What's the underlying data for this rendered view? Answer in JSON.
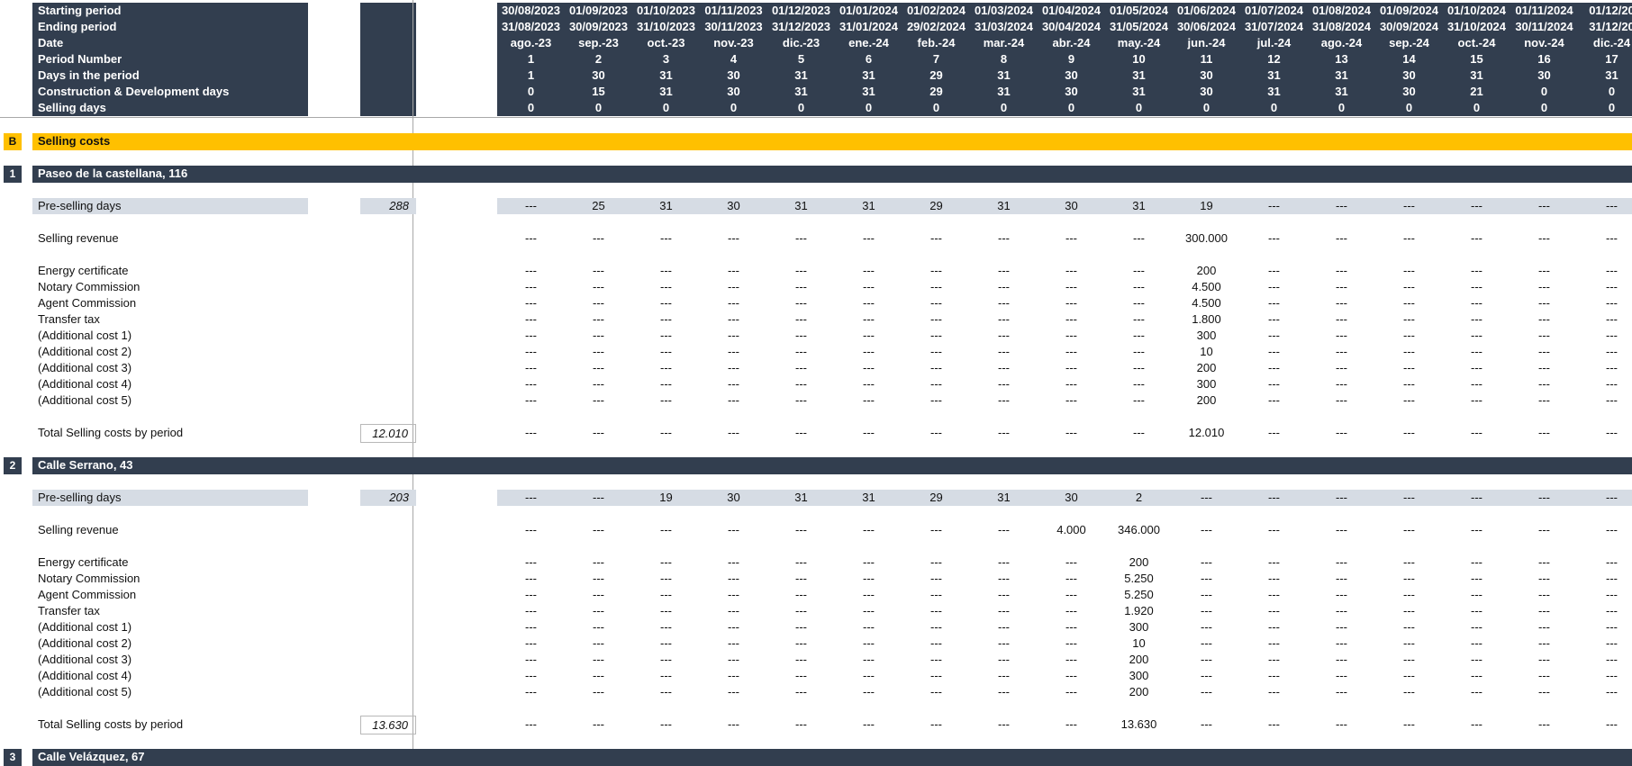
{
  "header": {
    "row_labels": [
      "Starting period",
      "Ending period",
      "Date",
      "Period Number",
      "Days in the period",
      "Construction & Development days",
      "Selling days"
    ],
    "columns": [
      {
        "start": "30/08/2023",
        "end": "31/08/2023",
        "date": "ago.-23",
        "num": "1",
        "days": "1",
        "cdev": "0",
        "sell": "0"
      },
      {
        "start": "01/09/2023",
        "end": "30/09/2023",
        "date": "sep.-23",
        "num": "2",
        "days": "30",
        "cdev": "15",
        "sell": "0"
      },
      {
        "start": "01/10/2023",
        "end": "31/10/2023",
        "date": "oct.-23",
        "num": "3",
        "days": "31",
        "cdev": "31",
        "sell": "0"
      },
      {
        "start": "01/11/2023",
        "end": "30/11/2023",
        "date": "nov.-23",
        "num": "4",
        "days": "30",
        "cdev": "30",
        "sell": "0"
      },
      {
        "start": "01/12/2023",
        "end": "31/12/2023",
        "date": "dic.-23",
        "num": "5",
        "days": "31",
        "cdev": "31",
        "sell": "0"
      },
      {
        "start": "01/01/2024",
        "end": "31/01/2024",
        "date": "ene.-24",
        "num": "6",
        "days": "31",
        "cdev": "31",
        "sell": "0"
      },
      {
        "start": "01/02/2024",
        "end": "29/02/2024",
        "date": "feb.-24",
        "num": "7",
        "days": "29",
        "cdev": "29",
        "sell": "0"
      },
      {
        "start": "01/03/2024",
        "end": "31/03/2024",
        "date": "mar.-24",
        "num": "8",
        "days": "31",
        "cdev": "31",
        "sell": "0"
      },
      {
        "start": "01/04/2024",
        "end": "30/04/2024",
        "date": "abr.-24",
        "num": "9",
        "days": "30",
        "cdev": "30",
        "sell": "0"
      },
      {
        "start": "01/05/2024",
        "end": "31/05/2024",
        "date": "may.-24",
        "num": "10",
        "days": "31",
        "cdev": "31",
        "sell": "0"
      },
      {
        "start": "01/06/2024",
        "end": "30/06/2024",
        "date": "jun.-24",
        "num": "11",
        "days": "30",
        "cdev": "30",
        "sell": "0"
      },
      {
        "start": "01/07/2024",
        "end": "31/07/2024",
        "date": "jul.-24",
        "num": "12",
        "days": "31",
        "cdev": "31",
        "sell": "0"
      },
      {
        "start": "01/08/2024",
        "end": "31/08/2024",
        "date": "ago.-24",
        "num": "13",
        "days": "31",
        "cdev": "31",
        "sell": "0"
      },
      {
        "start": "01/09/2024",
        "end": "30/09/2024",
        "date": "sep.-24",
        "num": "14",
        "days": "30",
        "cdev": "30",
        "sell": "0"
      },
      {
        "start": "01/10/2024",
        "end": "31/10/2024",
        "date": "oct.-24",
        "num": "15",
        "days": "31",
        "cdev": "21",
        "sell": "0"
      },
      {
        "start": "01/11/2024",
        "end": "30/11/2024",
        "date": "nov.-24",
        "num": "16",
        "days": "30",
        "cdev": "0",
        "sell": "0"
      },
      {
        "start": "01/12/20",
        "end": "31/12/20",
        "date": "dic.-24",
        "num": "17",
        "days": "31",
        "cdev": "0",
        "sell": "0"
      }
    ]
  },
  "section_b": {
    "code": "B",
    "title": "Selling costs"
  },
  "properties": [
    {
      "num": "1",
      "name": "Paseo de la castellana, 116",
      "presell_label": "Pre-selling days",
      "presell_total": "288",
      "presell": [
        "---",
        "25",
        "31",
        "30",
        "31",
        "31",
        "29",
        "31",
        "30",
        "31",
        "19",
        "---",
        "---",
        "---",
        "---",
        "---",
        "---"
      ],
      "revenue_label": "Selling revenue",
      "revenue": [
        "---",
        "---",
        "---",
        "---",
        "---",
        "---",
        "---",
        "---",
        "---",
        "---",
        "300.000",
        "---",
        "---",
        "---",
        "---",
        "---",
        "---"
      ],
      "costs": [
        {
          "label": "Energy certificate",
          "values": [
            "---",
            "---",
            "---",
            "---",
            "---",
            "---",
            "---",
            "---",
            "---",
            "---",
            "200",
            "---",
            "---",
            "---",
            "---",
            "---",
            "---"
          ]
        },
        {
          "label": "Notary Commission",
          "values": [
            "---",
            "---",
            "---",
            "---",
            "---",
            "---",
            "---",
            "---",
            "---",
            "---",
            "4.500",
            "---",
            "---",
            "---",
            "---",
            "---",
            "---"
          ]
        },
        {
          "label": "Agent Commission",
          "values": [
            "---",
            "---",
            "---",
            "---",
            "---",
            "---",
            "---",
            "---",
            "---",
            "---",
            "4.500",
            "---",
            "---",
            "---",
            "---",
            "---",
            "---"
          ]
        },
        {
          "label": "Transfer tax",
          "values": [
            "---",
            "---",
            "---",
            "---",
            "---",
            "---",
            "---",
            "---",
            "---",
            "---",
            "1.800",
            "---",
            "---",
            "---",
            "---",
            "---",
            "---"
          ]
        },
        {
          "label": "(Additional cost 1)",
          "values": [
            "---",
            "---",
            "---",
            "---",
            "---",
            "---",
            "---",
            "---",
            "---",
            "---",
            "300",
            "---",
            "---",
            "---",
            "---",
            "---",
            "---"
          ]
        },
        {
          "label": "(Additional cost 2)",
          "values": [
            "---",
            "---",
            "---",
            "---",
            "---",
            "---",
            "---",
            "---",
            "---",
            "---",
            "10",
            "---",
            "---",
            "---",
            "---",
            "---",
            "---"
          ]
        },
        {
          "label": "(Additional cost 3)",
          "values": [
            "---",
            "---",
            "---",
            "---",
            "---",
            "---",
            "---",
            "---",
            "---",
            "---",
            "200",
            "---",
            "---",
            "---",
            "---",
            "---",
            "---"
          ]
        },
        {
          "label": "(Additional cost 4)",
          "values": [
            "---",
            "---",
            "---",
            "---",
            "---",
            "---",
            "---",
            "---",
            "---",
            "---",
            "300",
            "---",
            "---",
            "---",
            "---",
            "---",
            "---"
          ]
        },
        {
          "label": "(Additional cost 5)",
          "values": [
            "---",
            "---",
            "---",
            "---",
            "---",
            "---",
            "---",
            "---",
            "---",
            "---",
            "200",
            "---",
            "---",
            "---",
            "---",
            "---",
            "---"
          ]
        }
      ],
      "total_label": "Total Selling costs by period",
      "total_sum": "12.010",
      "total": [
        "---",
        "---",
        "---",
        "---",
        "---",
        "---",
        "---",
        "---",
        "---",
        "---",
        "12.010",
        "---",
        "---",
        "---",
        "---",
        "---",
        "---"
      ]
    },
    {
      "num": "2",
      "name": "Calle Serrano, 43",
      "presell_label": "Pre-selling days",
      "presell_total": "203",
      "presell": [
        "---",
        "---",
        "19",
        "30",
        "31",
        "31",
        "29",
        "31",
        "30",
        "2",
        "---",
        "---",
        "---",
        "---",
        "---",
        "---",
        "---"
      ],
      "revenue_label": "Selling revenue",
      "revenue": [
        "---",
        "---",
        "---",
        "---",
        "---",
        "---",
        "---",
        "---",
        "4.000",
        "346.000",
        "---",
        "---",
        "---",
        "---",
        "---",
        "---",
        "---"
      ],
      "costs": [
        {
          "label": "Energy certificate",
          "values": [
            "---",
            "---",
            "---",
            "---",
            "---",
            "---",
            "---",
            "---",
            "---",
            "200",
            "---",
            "---",
            "---",
            "---",
            "---",
            "---",
            "---"
          ]
        },
        {
          "label": "Notary Commission",
          "values": [
            "---",
            "---",
            "---",
            "---",
            "---",
            "---",
            "---",
            "---",
            "---",
            "5.250",
            "---",
            "---",
            "---",
            "---",
            "---",
            "---",
            "---"
          ]
        },
        {
          "label": "Agent Commission",
          "values": [
            "---",
            "---",
            "---",
            "---",
            "---",
            "---",
            "---",
            "---",
            "---",
            "5.250",
            "---",
            "---",
            "---",
            "---",
            "---",
            "---",
            "---"
          ]
        },
        {
          "label": "Transfer tax",
          "values": [
            "---",
            "---",
            "---",
            "---",
            "---",
            "---",
            "---",
            "---",
            "---",
            "1.920",
            "---",
            "---",
            "---",
            "---",
            "---",
            "---",
            "---"
          ]
        },
        {
          "label": "(Additional cost 1)",
          "values": [
            "---",
            "---",
            "---",
            "---",
            "---",
            "---",
            "---",
            "---",
            "---",
            "300",
            "---",
            "---",
            "---",
            "---",
            "---",
            "---",
            "---"
          ]
        },
        {
          "label": "(Additional cost 2)",
          "values": [
            "---",
            "---",
            "---",
            "---",
            "---",
            "---",
            "---",
            "---",
            "---",
            "10",
            "---",
            "---",
            "---",
            "---",
            "---",
            "---",
            "---"
          ]
        },
        {
          "label": "(Additional cost 3)",
          "values": [
            "---",
            "---",
            "---",
            "---",
            "---",
            "---",
            "---",
            "---",
            "---",
            "200",
            "---",
            "---",
            "---",
            "---",
            "---",
            "---",
            "---"
          ]
        },
        {
          "label": "(Additional cost 4)",
          "values": [
            "---",
            "---",
            "---",
            "---",
            "---",
            "---",
            "---",
            "---",
            "---",
            "300",
            "---",
            "---",
            "---",
            "---",
            "---",
            "---",
            "---"
          ]
        },
        {
          "label": "(Additional cost 5)",
          "values": [
            "---",
            "---",
            "---",
            "---",
            "---",
            "---",
            "---",
            "---",
            "---",
            "200",
            "---",
            "---",
            "---",
            "---",
            "---",
            "---",
            "---"
          ]
        }
      ],
      "total_label": "Total Selling costs by period",
      "total_sum": "13.630",
      "total": [
        "---",
        "---",
        "---",
        "---",
        "---",
        "---",
        "---",
        "---",
        "---",
        "13.630",
        "---",
        "---",
        "---",
        "---",
        "---",
        "---",
        "---"
      ]
    }
  ],
  "property3": {
    "num": "3",
    "name": "Calle Velázquez, 67"
  },
  "colors": {
    "navy": "#323e4f",
    "gold": "#ffc000",
    "grey": "#d6dce4"
  }
}
